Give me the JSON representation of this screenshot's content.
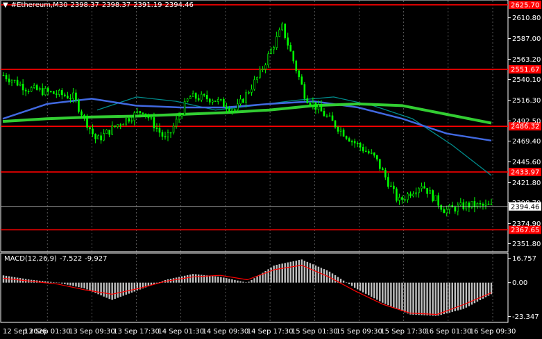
{
  "header": {
    "menu_icon": "triangle-down-icon",
    "symbol": "#Ethereum,M30",
    "open": "2398.37",
    "high": "2398.37",
    "low": "2391.19",
    "close": "2394.46"
  },
  "macd": {
    "label": "MACD(12,26,9)",
    "main": "-7.522",
    "signal": "-9.927",
    "axis_labels": [
      "16.757",
      "0.00",
      "-23.347"
    ]
  },
  "price_axis": {
    "labels": [
      "2610.80",
      "2587.00",
      "2563.20",
      "2540.10",
      "2516.30",
      "2492.50",
      "2469.40",
      "2445.60",
      "2421.80",
      "2398.70",
      "2374.90",
      "2351.80"
    ],
    "current": "2394.46"
  },
  "levels": [
    {
      "label": "2625.70",
      "price": 2625.7
    },
    {
      "label": "2551.67",
      "price": 2551.67
    },
    {
      "label": "2486.32",
      "price": 2486.32
    },
    {
      "label": "2433.97",
      "price": 2433.97
    },
    {
      "label": "2367.65",
      "price": 2367.65
    }
  ],
  "time_axis": [
    "12 Sep 2026",
    "13 Sep 01:30",
    "13 Sep 09:30",
    "13 Sep 17:30",
    "14 Sep 01:30",
    "14 Sep 09:30",
    "14 Sep 17:30",
    "15 Sep 01:30",
    "15 Sep 09:30",
    "15 Sep 17:30",
    "16 Sep 01:30",
    "16 Sep 09:30"
  ],
  "colors": {
    "background": "#000000",
    "candle": "#00ff00",
    "level": "#ff0000",
    "ma_fast": "#008b8b",
    "ma_mid": "#4169e1",
    "ma_slow": "#32cd32",
    "macd_hist": "#c0c0c0",
    "macd_signal": "#ff0000",
    "axis_text": "#ffffff"
  },
  "chart_data": {
    "type": "candlestick",
    "price_series": [
      {
        "x": "12 Sep 2026",
        "y": 2545
      },
      {
        "x": "12 Sep 2026",
        "y": 2530
      },
      {
        "x": "13 Sep 01:30",
        "y": 2525
      },
      {
        "x": "13 Sep 01:30",
        "y": 2520
      },
      {
        "x": "13 Sep 09:30",
        "y": 2470
      },
      {
        "x": "13 Sep 09:30",
        "y": 2490
      },
      {
        "x": "13 Sep 17:30",
        "y": 2505
      },
      {
        "x": "13 Sep 17:30",
        "y": 2470
      },
      {
        "x": "14 Sep 01:30",
        "y": 2520
      },
      {
        "x": "14 Sep 09:30",
        "y": 2518
      },
      {
        "x": "14 Sep 09:30",
        "y": 2505
      },
      {
        "x": "14 Sep 17:30",
        "y": 2545
      },
      {
        "x": "14 Sep 17:30",
        "y": 2600
      },
      {
        "x": "15 Sep 01:30",
        "y": 2520
      },
      {
        "x": "15 Sep 01:30",
        "y": 2495
      },
      {
        "x": "15 Sep 09:30",
        "y": 2470
      },
      {
        "x": "15 Sep 09:30",
        "y": 2450
      },
      {
        "x": "15 Sep 17:30",
        "y": 2400
      },
      {
        "x": "15 Sep 17:30",
        "y": 2420
      },
      {
        "x": "16 Sep 01:30",
        "y": 2390
      },
      {
        "x": "16 Sep 01:30",
        "y": 2396
      },
      {
        "x": "16 Sep 09:30",
        "y": 2394.46
      }
    ],
    "ma_slow": [
      2492,
      2495,
      2497,
      2498,
      2500,
      2502,
      2505,
      2510,
      2512,
      2510,
      2500,
      2490
    ],
    "ma_mid": [
      2495,
      2512,
      2518,
      2510,
      2508,
      2508,
      2512,
      2515,
      2508,
      2495,
      2478,
      2470
    ],
    "ma_fast": [
      2505,
      2520,
      2515,
      2505,
      2510,
      2516,
      2520,
      2510,
      2495,
      2465,
      2430
    ],
    "macd_hist": [
      5,
      2,
      0,
      -4,
      -12,
      -5,
      2,
      6,
      4,
      0,
      12,
      16,
      8,
      -4,
      -14,
      -22,
      -23,
      -18,
      -8
    ],
    "macd_signal": [
      3,
      1,
      -1,
      -5,
      -8,
      -4,
      1,
      4,
      5,
      2,
      9,
      12,
      4,
      -6,
      -15,
      -21,
      -22,
      -15,
      -7
    ],
    "ylim": [
      2345,
      2628
    ],
    "macd_ylim": [
      -26,
      19
    ]
  }
}
